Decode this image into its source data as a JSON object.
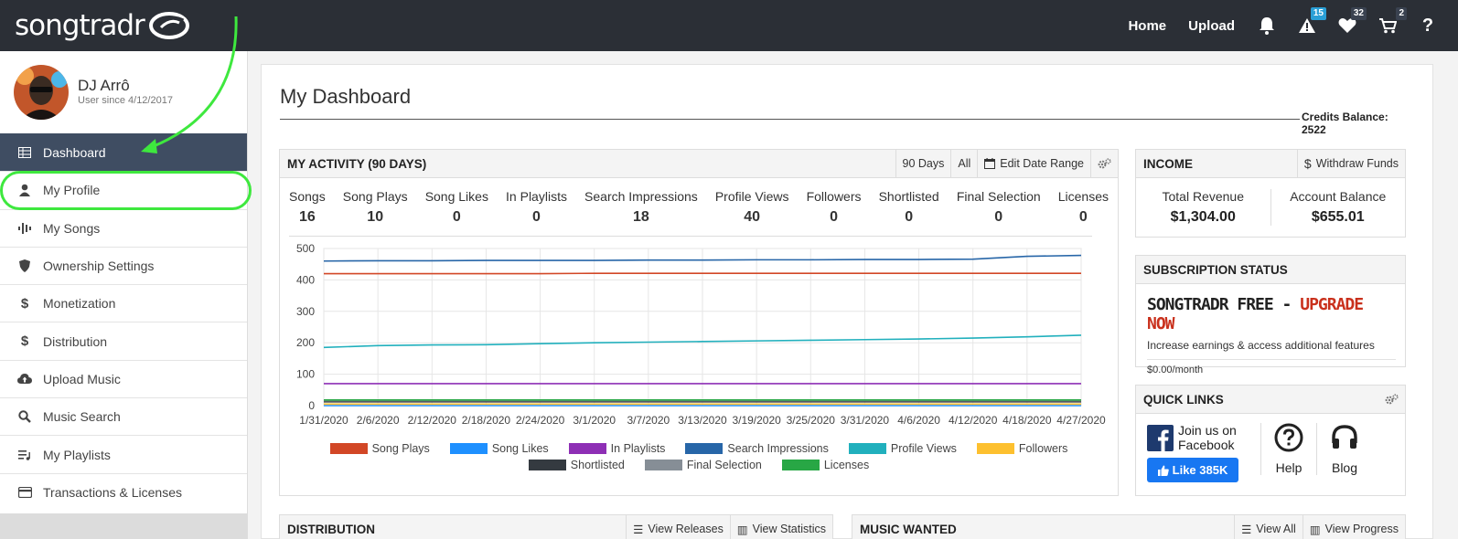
{
  "brand": {
    "name": "songtradr"
  },
  "topnav": {
    "home": "Home",
    "upload": "Upload",
    "alerts_count": "15",
    "favorites_count": "32",
    "cart_count": "2",
    "help": "?"
  },
  "user": {
    "name": "DJ Arrô",
    "since": "User since 4/12/2017"
  },
  "sidebar": {
    "items": [
      {
        "label": "Dashboard",
        "icon": "grid-icon",
        "active": true
      },
      {
        "label": "My Profile",
        "icon": "user-icon"
      },
      {
        "label": "My Songs",
        "icon": "waveform-icon"
      },
      {
        "label": "Ownership Settings",
        "icon": "shield-icon"
      },
      {
        "label": "Monetization",
        "icon": "dollar-icon"
      },
      {
        "label": "Distribution",
        "icon": "dollar-icon"
      },
      {
        "label": "Upload Music",
        "icon": "cloud-upload-icon"
      },
      {
        "label": "Music Search",
        "icon": "search-icon"
      },
      {
        "label": "My Playlists",
        "icon": "playlist-icon"
      },
      {
        "label": "Transactions & Licenses",
        "icon": "credit-card-icon"
      }
    ]
  },
  "page": {
    "title": "My Dashboard",
    "credits_label": "Credits Balance:",
    "credits_value": "2522"
  },
  "activity": {
    "title": "MY ACTIVITY (90 DAYS)",
    "btn_90": "90 Days",
    "btn_all": "All",
    "btn_range": "Edit Date Range",
    "stats": [
      {
        "label": "Songs",
        "value": "16"
      },
      {
        "label": "Song Plays",
        "value": "10"
      },
      {
        "label": "Song Likes",
        "value": "0"
      },
      {
        "label": "In Playlists",
        "value": "0"
      },
      {
        "label": "Search Impressions",
        "value": "18"
      },
      {
        "label": "Profile Views",
        "value": "40"
      },
      {
        "label": "Followers",
        "value": "0"
      },
      {
        "label": "Shortlisted",
        "value": "0"
      },
      {
        "label": "Final Selection",
        "value": "0"
      },
      {
        "label": "Licenses",
        "value": "0"
      }
    ]
  },
  "chart_data": {
    "type": "line",
    "x": [
      "1/31/2020",
      "2/6/2020",
      "2/12/2020",
      "2/18/2020",
      "2/24/2020",
      "3/1/2020",
      "3/7/2020",
      "3/13/2020",
      "3/19/2020",
      "3/25/2020",
      "3/31/2020",
      "4/6/2020",
      "4/12/2020",
      "4/18/2020",
      "4/27/2020"
    ],
    "ylim": [
      0,
      500
    ],
    "yticks": [
      "0",
      "100",
      "200",
      "300",
      "400",
      "500"
    ],
    "grid": true,
    "legend_position": "bottom",
    "series": [
      {
        "name": "Song Plays",
        "color": "#d24726",
        "values": [
          420,
          420,
          420,
          420,
          420,
          421,
          421,
          421,
          421,
          421,
          421,
          421,
          421,
          421,
          421
        ]
      },
      {
        "name": "Song Likes",
        "color": "#1e90ff",
        "values": [
          0,
          0,
          0,
          0,
          0,
          0,
          0,
          0,
          0,
          0,
          0,
          0,
          0,
          0,
          0
        ]
      },
      {
        "name": "In Playlists",
        "color": "#8e2fb5",
        "values": [
          70,
          70,
          70,
          70,
          70,
          70,
          70,
          70,
          70,
          70,
          70,
          70,
          70,
          70,
          70
        ]
      },
      {
        "name": "Search Impressions",
        "color": "#2766a8",
        "values": [
          460,
          461,
          461,
          462,
          462,
          462,
          463,
          463,
          464,
          464,
          465,
          465,
          466,
          475,
          478
        ]
      },
      {
        "name": "Profile Views",
        "color": "#21b0bd",
        "values": [
          185,
          191,
          193,
          194,
          197,
          200,
          202,
          204,
          206,
          208,
          210,
          212,
          215,
          219,
          224
        ]
      },
      {
        "name": "Followers",
        "color": "#fdc02f",
        "values": [
          5,
          5,
          5,
          5,
          5,
          5,
          5,
          5,
          5,
          5,
          5,
          5,
          5,
          5,
          5
        ]
      },
      {
        "name": "Shortlisted",
        "color": "#343a40",
        "values": [
          12,
          12,
          12,
          12,
          12,
          12,
          12,
          12,
          12,
          12,
          12,
          12,
          12,
          12,
          12
        ]
      },
      {
        "name": "Final Selection",
        "color": "#868e96",
        "values": [
          16,
          16,
          16,
          16,
          16,
          16,
          16,
          16,
          16,
          16,
          16,
          16,
          16,
          16,
          16
        ]
      },
      {
        "name": "Licenses",
        "color": "#28a745",
        "values": [
          18,
          18,
          18,
          18,
          18,
          18,
          18,
          18,
          18,
          18,
          18,
          18,
          18,
          18,
          18
        ]
      }
    ]
  },
  "income": {
    "title": "INCOME",
    "withdraw": "Withdraw Funds",
    "total_label": "Total Revenue",
    "total_value": "$1,304.00",
    "balance_label": "Account Balance",
    "balance_value": "$655.01"
  },
  "subscription": {
    "title": "SUBSCRIPTION STATUS",
    "plan": "SONGTRADR FREE - ",
    "upgrade": "UPGRADE NOW",
    "desc": "Increase earnings & access additional features",
    "price": "$0.00/month"
  },
  "quick_links": {
    "title": "QUICK LINKS",
    "fb_line1": "Join us on",
    "fb_line2": "Facebook",
    "fb_like": "Like 385K",
    "help": "Help",
    "blog": "Blog"
  },
  "distribution": {
    "title": "DISTRIBUTION",
    "view_releases": "View Releases",
    "view_statistics": "View Statistics"
  },
  "music_wanted": {
    "title": "MUSIC WANTED",
    "view_all": "View All",
    "view_progress": "View Progress"
  },
  "colors": {
    "topbar": "#2b2f36",
    "sidebar_active": "#3f4d62",
    "highlight": "#3ee83e",
    "upgrade": "#c9301c"
  }
}
